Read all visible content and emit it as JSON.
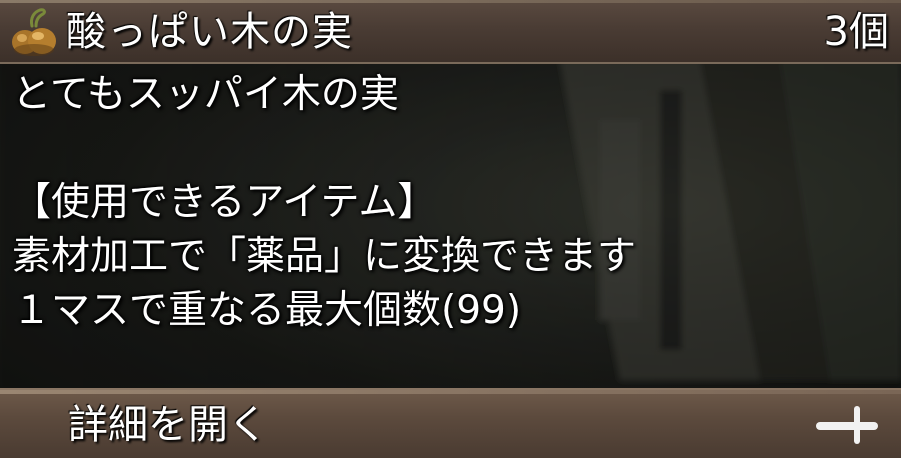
{
  "item": {
    "name": "酸っぱい木の実",
    "count": "3個",
    "icon": "nut-fruit-icon"
  },
  "description": {
    "lines": [
      "とてもスッパイ木の実",
      "",
      "【使用できるアイテム】",
      "素材加工で「薬品」に変換できます",
      "１マスで重なる最大個数(99)"
    ]
  },
  "footer": {
    "detail_label": "詳細を開く",
    "expand_icon": "plus-icon"
  },
  "colors": {
    "text": "#ffffff",
    "header_bar": "#4a3c34",
    "footer_bar": "#5c4a3d",
    "background": "#1a1b18"
  }
}
